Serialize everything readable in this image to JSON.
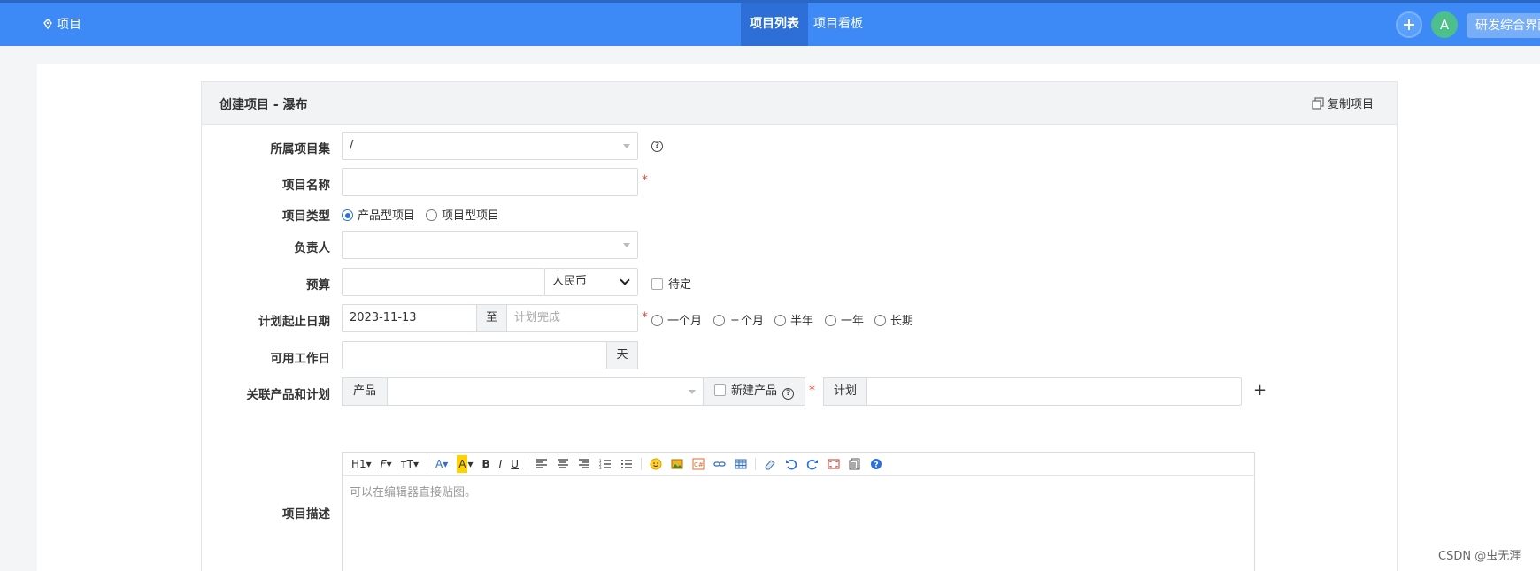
{
  "header": {
    "brand": "项目",
    "tabs": [
      "项目列表",
      "项目看板"
    ],
    "avatar": "A",
    "workspace": "研发综合界面"
  },
  "panel": {
    "title": "创建项目 - 瀑布",
    "copy_label": "复制项目"
  },
  "form": {
    "program": {
      "label": "所属项目集",
      "value": "/"
    },
    "name": {
      "label": "项目名称",
      "value": ""
    },
    "type": {
      "label": "项目类型",
      "options": [
        "产品型项目",
        "项目型项目"
      ],
      "selected": "产品型项目"
    },
    "owner": {
      "label": "负责人",
      "value": ""
    },
    "budget": {
      "label": "预算",
      "currency": "人民币",
      "pending_label": "待定"
    },
    "dates": {
      "label": "计划起止日期",
      "begin": "2023-11-13",
      "to": "至",
      "end_placeholder": "计划完成",
      "quick": [
        "一个月",
        "三个月",
        "半年",
        "一年",
        "长期"
      ]
    },
    "workdays": {
      "label": "可用工作日",
      "unit": "天"
    },
    "products": {
      "label": "关联产品和计划",
      "product_addon": "产品",
      "new_product_label": "新建产品",
      "plan_addon": "计划"
    },
    "desc": {
      "label": "项目描述",
      "placeholder": "可以在编辑器直接贴图。"
    }
  },
  "editor_toolbar": [
    "H1",
    "F",
    "тT",
    "A",
    "A",
    "B",
    "I",
    "U"
  ],
  "watermark": "CSDN @虫无涯",
  "colors": {
    "header": "#3d8af7",
    "header_active": "#2d6fd6",
    "required": "#e34a3a"
  }
}
